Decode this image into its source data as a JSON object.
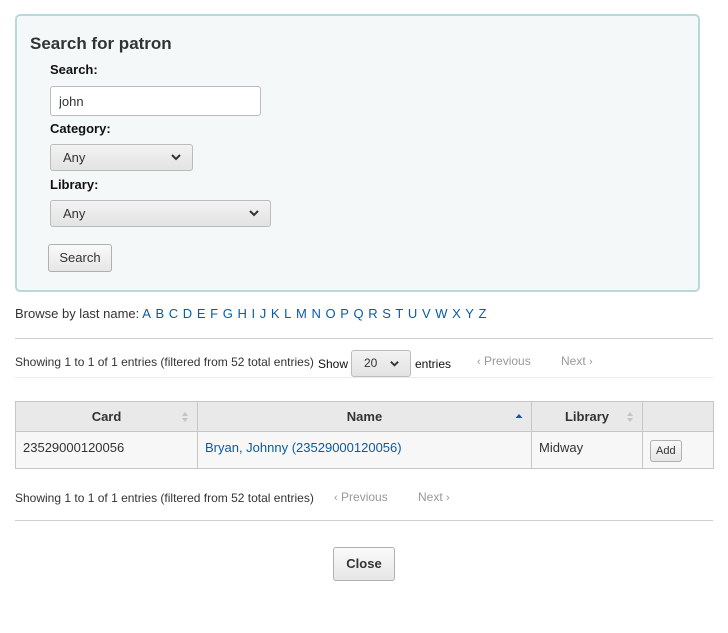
{
  "search_panel": {
    "title": "Search for patron",
    "search_label": "Search:",
    "search_value": "john",
    "category_label": "Category:",
    "category_selected": "Any",
    "library_label": "Library:",
    "library_selected": "Any",
    "search_button": "Search"
  },
  "browse": {
    "label": "Browse by last name:",
    "letters": [
      "A",
      "B",
      "C",
      "D",
      "E",
      "F",
      "G",
      "H",
      "I",
      "J",
      "K",
      "L",
      "M",
      "N",
      "O",
      "P",
      "Q",
      "R",
      "S",
      "T",
      "U",
      "V",
      "W",
      "X",
      "Y",
      "Z"
    ]
  },
  "table_top": {
    "info": "Showing 1 to 1 of 1 entries (filtered from 52 total entries)",
    "show_label": "Show",
    "page_length": "20",
    "entries_label": "entries",
    "previous": "Previous",
    "next": "Next"
  },
  "table": {
    "columns": [
      "Card",
      "Name",
      "Library",
      ""
    ],
    "rows": [
      {
        "card": "23529000120056",
        "name": "Bryan, Johnny (23529000120056)",
        "library": "Midway",
        "action": "Add"
      }
    ]
  },
  "table_bottom": {
    "info": "Showing 1 to 1 of 1 entries (filtered from 52 total entries)",
    "previous": "Previous",
    "next": "Next"
  },
  "close_button": "Close"
}
